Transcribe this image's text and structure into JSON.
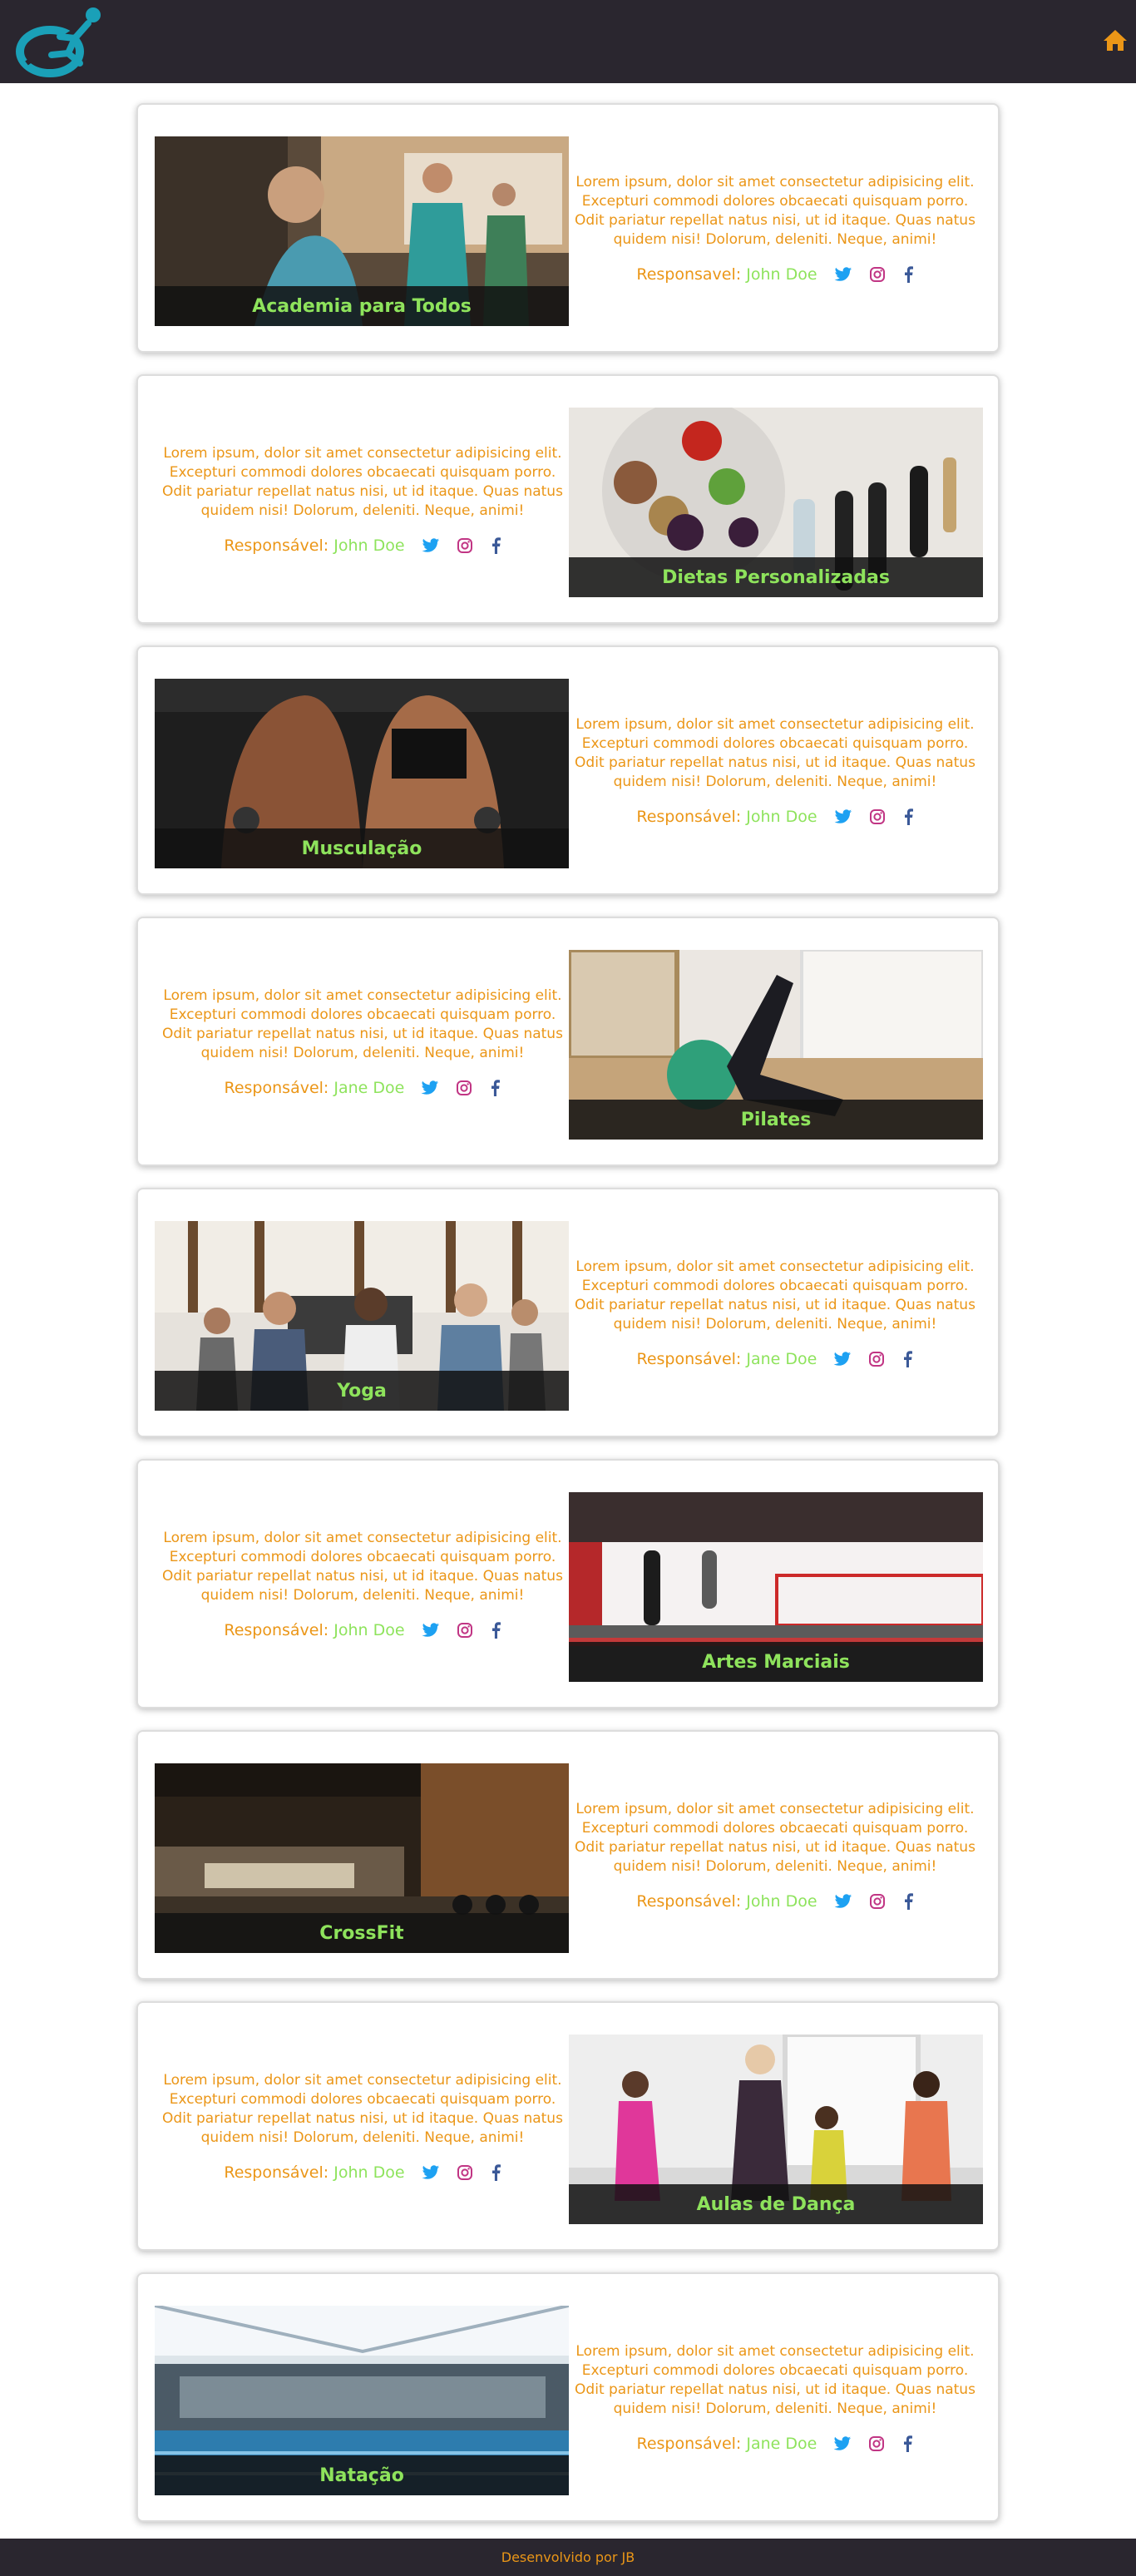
{
  "header": {
    "logo_icon": "runner-logo-icon",
    "home_icon": "home-icon"
  },
  "cards": [
    {
      "image": "gym-treadmill-photo",
      "title": "Academia para Todos",
      "text": "Lorem ipsum, dolor sit amet consectetur adipisicing elit. Excepturi commodi dolores obcaecati quisquam porro. Odit pariatur repellat natus nisi, ut id itaque. Quas natus quidem nisi! Dolorum, deleniti. Neque, animi!",
      "resp_label": "Responsavel:",
      "resp_name": "John Doe"
    },
    {
      "image": "healthy-food-photo",
      "title": "Dietas Personalizadas",
      "text": "Lorem ipsum, dolor sit amet consectetur adipisicing elit. Excepturi commodi dolores obcaecati quisquam porro. Odit pariatur repellat natus nisi, ut id itaque. Quas natus quidem nisi! Dolorum, deleniti. Neque, animi!",
      "resp_label": "Responsável:",
      "resp_name": "John Doe"
    },
    {
      "image": "bodybuilders-photo",
      "title": "Musculação",
      "text": "Lorem ipsum, dolor sit amet consectetur adipisicing elit. Excepturi commodi dolores obcaecati quisquam porro. Odit pariatur repellat natus nisi, ut id itaque. Quas natus quidem nisi! Dolorum, deleniti. Neque, animi!",
      "resp_label": "Responsável:",
      "resp_name": "John Doe"
    },
    {
      "image": "pilates-ball-photo",
      "title": "Pilates",
      "text": "Lorem ipsum, dolor sit amet consectetur adipisicing elit. Excepturi commodi dolores obcaecati quisquam porro. Odit pariatur repellat natus nisi, ut id itaque. Quas natus quidem nisi! Dolorum, deleniti. Neque, animi!",
      "resp_label": "Responsável:",
      "resp_name": "Jane Doe"
    },
    {
      "image": "yoga-class-photo",
      "title": "Yoga",
      "text": "Lorem ipsum, dolor sit amet consectetur adipisicing elit. Excepturi commodi dolores obcaecati quisquam porro. Odit pariatur repellat natus nisi, ut id itaque. Quas natus quidem nisi! Dolorum, deleniti. Neque, animi!",
      "resp_label": "Responsável:",
      "resp_name": "Jane Doe"
    },
    {
      "image": "boxing-gym-photo",
      "title": "Artes Marciais",
      "text": "Lorem ipsum, dolor sit amet consectetur adipisicing elit. Excepturi commodi dolores obcaecati quisquam porro. Odit pariatur repellat natus nisi, ut id itaque. Quas natus quidem nisi! Dolorum, deleniti. Neque, animi!",
      "resp_label": "Responsável:",
      "resp_name": "John Doe"
    },
    {
      "image": "crossfit-gym-photo",
      "title": "CrossFit",
      "text": "Lorem ipsum, dolor sit amet consectetur adipisicing elit. Excepturi commodi dolores obcaecati quisquam porro. Odit pariatur repellat natus nisi, ut id itaque. Quas natus quidem nisi! Dolorum, deleniti. Neque, animi!",
      "resp_label": "Responsável:",
      "resp_name": "John Doe"
    },
    {
      "image": "dance-class-photo",
      "title": "Aulas de Dança",
      "text": "Lorem ipsum, dolor sit amet consectetur adipisicing elit. Excepturi commodi dolores obcaecati quisquam porro. Odit pariatur repellat natus nisi, ut id itaque. Quas natus quidem nisi! Dolorum, deleniti. Neque, animi!",
      "resp_label": "Responsável:",
      "resp_name": "John Doe"
    },
    {
      "image": "swimming-pool-photo",
      "title": "Natação",
      "text": "Lorem ipsum, dolor sit amet consectetur adipisicing elit. Excepturi commodi dolores obcaecati quisquam porro. Odit pariatur repellat natus nisi, ut id itaque. Quas natus quidem nisi! Dolorum, deleniti. Neque, animi!",
      "resp_label": "Responsável:",
      "resp_name": "Jane Doe"
    }
  ],
  "social_icons": [
    "twitter-icon",
    "instagram-icon",
    "facebook-icon"
  ],
  "footer": {
    "text": "Desenvolvido por",
    "author": "JB"
  },
  "colors": {
    "header_bg": "#2a262f",
    "accent_orange": "#eb9617",
    "accent_green": "#8ee35c",
    "twitter": "#1da1f2",
    "instagram": "#c13584",
    "facebook": "#3b5998"
  }
}
